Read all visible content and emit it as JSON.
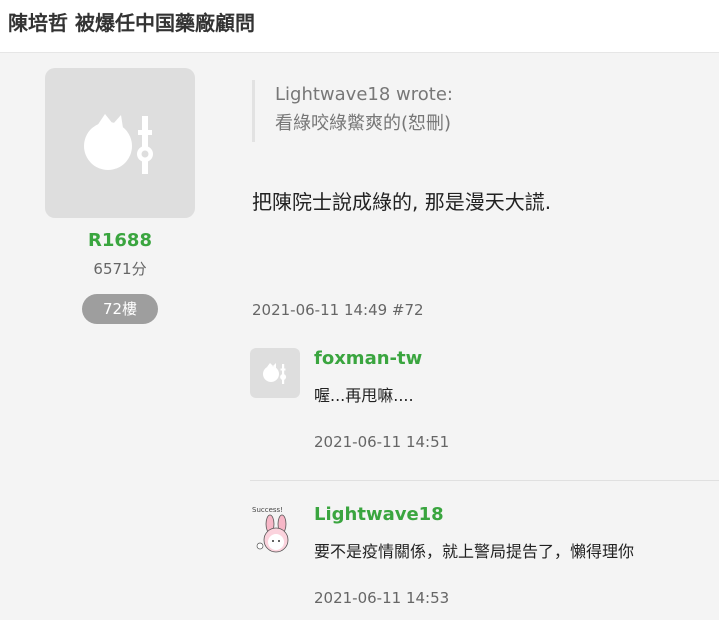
{
  "header": {
    "title": "陳培哲 被爆任中国藥廠顧問"
  },
  "author": {
    "avatar_icon": "default-avatar-icon",
    "name": "R1688",
    "points": "6571分",
    "floor": "72樓"
  },
  "post": {
    "quote_author": "Lightwave18 wrote:",
    "quote_text": "看綠咬綠鱉爽的(恕刪)",
    "body": "把陳院士說成綠的, 那是漫天大謊.",
    "meta": "2021-06-11 14:49 #72"
  },
  "replies": [
    {
      "avatar_icon": "default-avatar-icon",
      "user": "foxman-tw",
      "text": "喔...再甩嘛....",
      "time": "2021-06-11 14:51"
    },
    {
      "avatar_icon": "bunny-sticker-icon",
      "user": "Lightwave18",
      "text": "要不是疫情關係，就上警局提告了，懶得理你",
      "time": "2021-06-11 14:53"
    }
  ],
  "colors": {
    "username": "#3aa53f",
    "badge": "#9e9e9e",
    "background": "#f4f4f4"
  }
}
